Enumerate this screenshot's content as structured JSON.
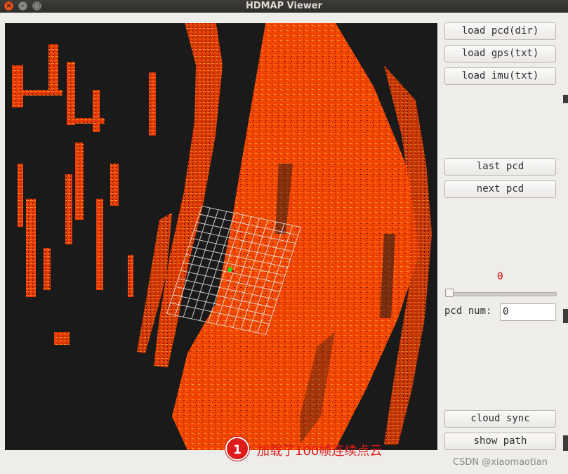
{
  "window": {
    "title": "HDMAP Viewer"
  },
  "buttons": {
    "load_pcd": "load pcd(dir)",
    "load_gps": "load gps(txt)",
    "load_imu": "load imu(txt)",
    "last_pcd": "last pcd",
    "next_pcd": "next pcd",
    "cloud_sync": "cloud sync",
    "show_path": "show path"
  },
  "frame_counter": "0",
  "slider": {
    "value": 0
  },
  "pcd_num": {
    "label": "pcd num:",
    "value": "0"
  },
  "annotation": {
    "number": "1",
    "text": "加载了100帧连续点云"
  },
  "watermark": "CSDN @xiaomaotian",
  "colors": {
    "point_cloud": "#ff4a00",
    "grid": "#dddddd",
    "annotation": "#e01b1b",
    "viewer_bg": "#1a1a1a"
  }
}
